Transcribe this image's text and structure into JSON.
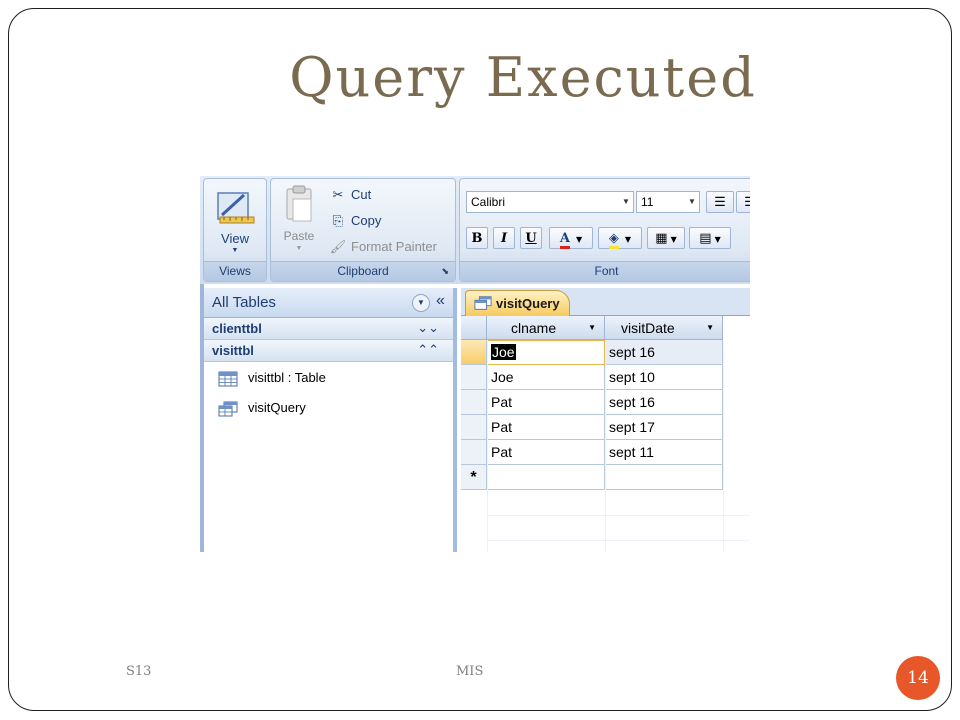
{
  "slide": {
    "title": "Query Executed",
    "footer_left": "S13",
    "footer_center": "MIS",
    "page_number": "14"
  },
  "ribbon": {
    "views": {
      "view_label": "View",
      "group_label": "Views"
    },
    "clipboard": {
      "paste_label": "Paste",
      "cut_label": "Cut",
      "copy_label": "Copy",
      "format_painter_label": "Format Painter",
      "group_label": "Clipboard"
    },
    "font": {
      "font_name": "Calibri",
      "font_size": "11",
      "bold": "B",
      "italic": "I",
      "underline": "U",
      "font_color": "A",
      "group_label": "Font"
    }
  },
  "nav": {
    "title": "All Tables",
    "groups": [
      {
        "label": "clienttbl",
        "expanded": false
      },
      {
        "label": "visittbl",
        "expanded": true
      }
    ],
    "items": [
      {
        "label": "visittbl : Table",
        "icon": "table-icon"
      },
      {
        "label": "visitQuery",
        "icon": "query-icon"
      }
    ]
  },
  "datasheet": {
    "tab_label": "visitQuery",
    "columns": [
      "clname",
      "visitDate"
    ],
    "rows": [
      [
        "Joe",
        "sept 16"
      ],
      [
        "Joe",
        "sept 10"
      ],
      [
        "Pat",
        "sept 16"
      ],
      [
        "Pat",
        "sept 17"
      ],
      [
        "Pat",
        "sept 11"
      ]
    ],
    "new_record_marker": "*"
  }
}
